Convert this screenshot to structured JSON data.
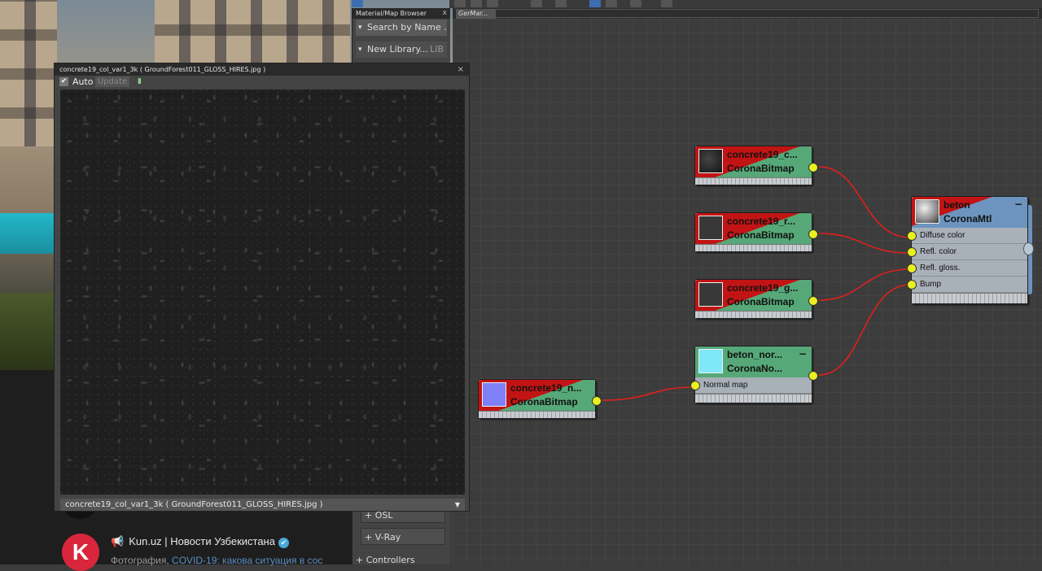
{
  "viewer": {
    "title": "concrete19_col_var1_3k ( GroundForest011_GLOSS_HIRES.jpg )",
    "auto_label": "Auto",
    "auto_checked": "✔",
    "update_label": "Update",
    "footer": "concrete19_col_var1_3k ( GroundForest011_GLOSS_HIRES.jpg )",
    "footer_arrow": "▼"
  },
  "browser": {
    "title": "Material/Map Browser",
    "close": "x",
    "search_placeholder": "Search by Name ...",
    "new_library": "New Library...",
    "new_library_tag": "LIB",
    "items": [
      "+ OSL",
      "+ V-Ray"
    ],
    "controllers": "+ Controllers"
  },
  "tab": {
    "label": "GerMar..."
  },
  "nodes": {
    "bitmap1": {
      "name": "concrete19_c...",
      "type": "CoronaBitmap"
    },
    "bitmap2": {
      "name": "concrete19_r...",
      "type": "CoronaBitmap"
    },
    "bitmap3": {
      "name": "concrete19_g...",
      "type": "CoronaBitmap"
    },
    "bitmap4": {
      "name": "concrete19_n...",
      "type": "CoronaBitmap"
    },
    "normal": {
      "name": "beton_nor...",
      "type": "CoronaNo...",
      "slot": "Normal map",
      "minus": "−"
    },
    "material": {
      "name": "beton",
      "type": "CoronaMtl",
      "minus": "−",
      "slots": [
        "Diffuse color",
        "Refl. color",
        "Refl. gloss.",
        "Bump"
      ]
    }
  },
  "telegram": {
    "channel": "Kun.uz | Новости Узбекистана",
    "avatar_letter": "K",
    "verified": "✔",
    "preview_prefix": "Фотография,",
    "preview_text": " COVID-19: какова ситуация в сос"
  },
  "colors": {
    "port": "#e8f020",
    "wire": "#e0201c",
    "map_node": "#56a878",
    "mtl_node": "#6c94be"
  }
}
